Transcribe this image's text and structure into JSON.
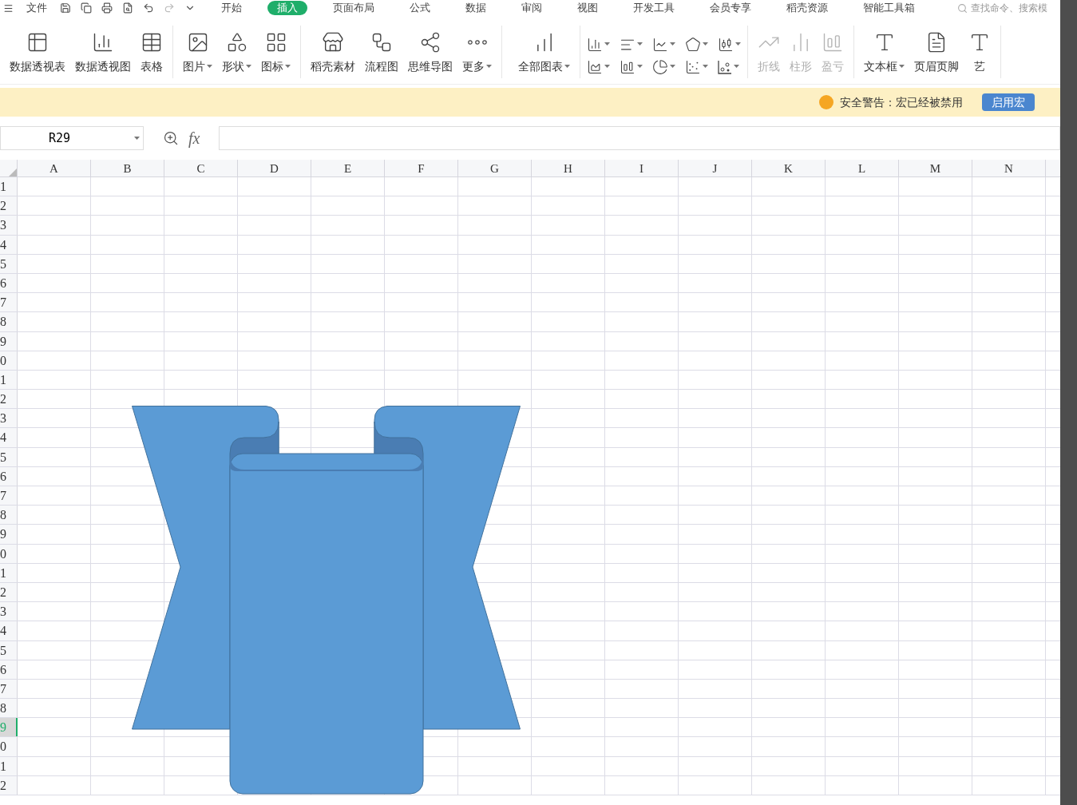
{
  "menu_tabs": [
    {
      "label": "文件",
      "selected": false
    },
    {
      "label": "开始",
      "selected": false
    },
    {
      "label": "插入",
      "selected": true
    },
    {
      "label": "页面布局",
      "selected": false
    },
    {
      "label": "公式",
      "selected": false
    },
    {
      "label": "数据",
      "selected": false
    },
    {
      "label": "审阅",
      "selected": false
    },
    {
      "label": "视图",
      "selected": false
    },
    {
      "label": "开发工具",
      "selected": false
    },
    {
      "label": "会员专享",
      "selected": false
    },
    {
      "label": "稻壳资源",
      "selected": false
    },
    {
      "label": "智能工具箱",
      "selected": false
    }
  ],
  "search": {
    "placeholder": "查找命令、搜索模"
  },
  "ribbon": [
    {
      "items": [
        {
          "label": "数据透视表",
          "dropdown": false,
          "disabled": false
        },
        {
          "label": "数据透视图",
          "dropdown": false,
          "disabled": false
        },
        {
          "label": "表格",
          "dropdown": false,
          "disabled": false
        }
      ]
    },
    {
      "items": [
        {
          "label": "图片",
          "dropdown": true,
          "disabled": false
        },
        {
          "label": "形状",
          "dropdown": true,
          "disabled": false
        },
        {
          "label": "图标",
          "dropdown": true,
          "disabled": false
        }
      ]
    },
    {
      "items": [
        {
          "label": "稻壳素材",
          "dropdown": false,
          "disabled": false
        },
        {
          "label": "流程图",
          "dropdown": false,
          "disabled": false
        },
        {
          "label": "思维导图",
          "dropdown": false,
          "disabled": false
        },
        {
          "label": "更多",
          "dropdown": true,
          "disabled": false
        }
      ]
    },
    {
      "items": [
        {
          "label": "全部图表",
          "dropdown": true,
          "disabled": false
        }
      ]
    },
    {
      "items": [
        {
          "label": "折线",
          "dropdown": false,
          "disabled": true
        },
        {
          "label": "柱形",
          "dropdown": false,
          "disabled": true
        },
        {
          "label": "盈亏",
          "dropdown": false,
          "disabled": true
        }
      ]
    },
    {
      "items": [
        {
          "label": "文本框",
          "dropdown": true,
          "disabled": false
        },
        {
          "label": "页眉页脚",
          "dropdown": false,
          "disabled": false
        },
        {
          "label": "艺",
          "dropdown": false,
          "disabled": false
        }
      ]
    }
  ],
  "security_bar": {
    "message": "安全警告：宏已经被禁用",
    "button": "启用宏"
  },
  "name_box": {
    "value": "R29"
  },
  "formula_bar": {
    "fx": "fx"
  },
  "columns": [
    "A",
    "B",
    "C",
    "D",
    "E",
    "F",
    "G",
    "H",
    "I",
    "J",
    "K",
    "L",
    "M",
    "N"
  ],
  "rows": [
    {
      "label": "1",
      "selected": false
    },
    {
      "label": "2",
      "selected": false
    },
    {
      "label": "3",
      "selected": false
    },
    {
      "label": "4",
      "selected": false
    },
    {
      "label": "5",
      "selected": false
    },
    {
      "label": "6",
      "selected": false
    },
    {
      "label": "7",
      "selected": false
    },
    {
      "label": "8",
      "selected": false
    },
    {
      "label": "9",
      "selected": false
    },
    {
      "label": "0",
      "selected": false
    },
    {
      "label": "1",
      "selected": false
    },
    {
      "label": "2",
      "selected": false
    },
    {
      "label": "3",
      "selected": false
    },
    {
      "label": "4",
      "selected": false
    },
    {
      "label": "5",
      "selected": false
    },
    {
      "label": "6",
      "selected": false
    },
    {
      "label": "7",
      "selected": false
    },
    {
      "label": "8",
      "selected": false
    },
    {
      "label": "9",
      "selected": false
    },
    {
      "label": "0",
      "selected": false
    },
    {
      "label": "1",
      "selected": false
    },
    {
      "label": "2",
      "selected": false
    },
    {
      "label": "3",
      "selected": false
    },
    {
      "label": "4",
      "selected": false
    },
    {
      "label": "5",
      "selected": false
    },
    {
      "label": "6",
      "selected": false
    },
    {
      "label": "7",
      "selected": false
    },
    {
      "label": "8",
      "selected": false
    },
    {
      "label": "9",
      "selected": true
    },
    {
      "label": "0",
      "selected": false
    },
    {
      "label": "1",
      "selected": false
    },
    {
      "label": "2",
      "selected": false
    }
  ]
}
